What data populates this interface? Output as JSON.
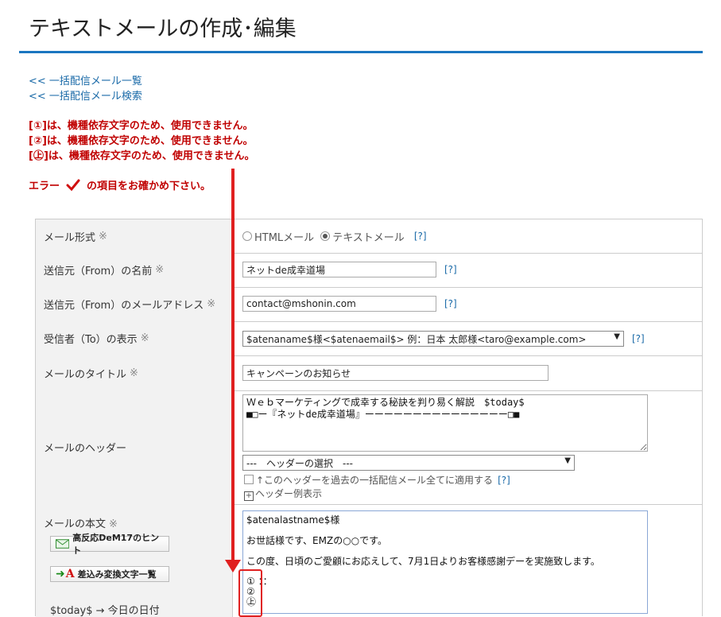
{
  "page": {
    "title": "テキストメールの作成･編集"
  },
  "links": [
    "<< 一括配信メール一覧",
    "<< 一括配信メール検索"
  ],
  "errors": [
    "[①]は、機種依存文字のため、使用できません。",
    "[②]は、機種依存文字のため、使用できません。",
    "[㊤]は、機種依存文字のため、使用できません。"
  ],
  "error_note": {
    "prefix": "エラー",
    "suffix": "の項目をお確かめ下さい。"
  },
  "form": {
    "required_mark": "※",
    "help": "[?]",
    "format": {
      "label": "メール形式",
      "html_option": "HTMLメール",
      "text_option": "テキストメール"
    },
    "from_name": {
      "label": "送信元（From）の名前",
      "value": "ネットde成幸道場"
    },
    "from_email": {
      "label": "送信元（From）のメールアドレス",
      "value": "contact@mshonin.com"
    },
    "to_display": {
      "label": "受信者（To）の表示",
      "value": "$atenaname$様<$atenaemail$>   例：日本 太郎様<taro@example.com>"
    },
    "subject": {
      "label": "メールのタイトル",
      "value": "キャンペーンのお知らせ"
    },
    "header": {
      "label": "メールのヘッダー",
      "value": "Ｗｅｂマーケティングで成幸する秘訣を判り易く解説　$today$\n■□ー『ネットde成幸道場』ーーーーーーーーーーーーーーー□■",
      "select_value": "---　ヘッダーの選択　---",
      "apply_all": "↑このヘッダーを過去の一括配信メール全てに適用する",
      "example": "ヘッダー例表示"
    },
    "body": {
      "label": "メールの本文",
      "hint_button": "高反応DeM17のヒント",
      "convert_button": "差込み変換文字一覧",
      "today_hint": "$today$ → 今日の日付",
      "lines": [
        "$atenalastname$様",
        "お世話様です、EMZの○○です。",
        "この度、日頃のご愛顧にお応えして、7月1日よりお客様感謝デーを実施致します。"
      ],
      "symbols": [
        "①",
        "②",
        "㊤"
      ],
      "dots": "：："
    }
  }
}
